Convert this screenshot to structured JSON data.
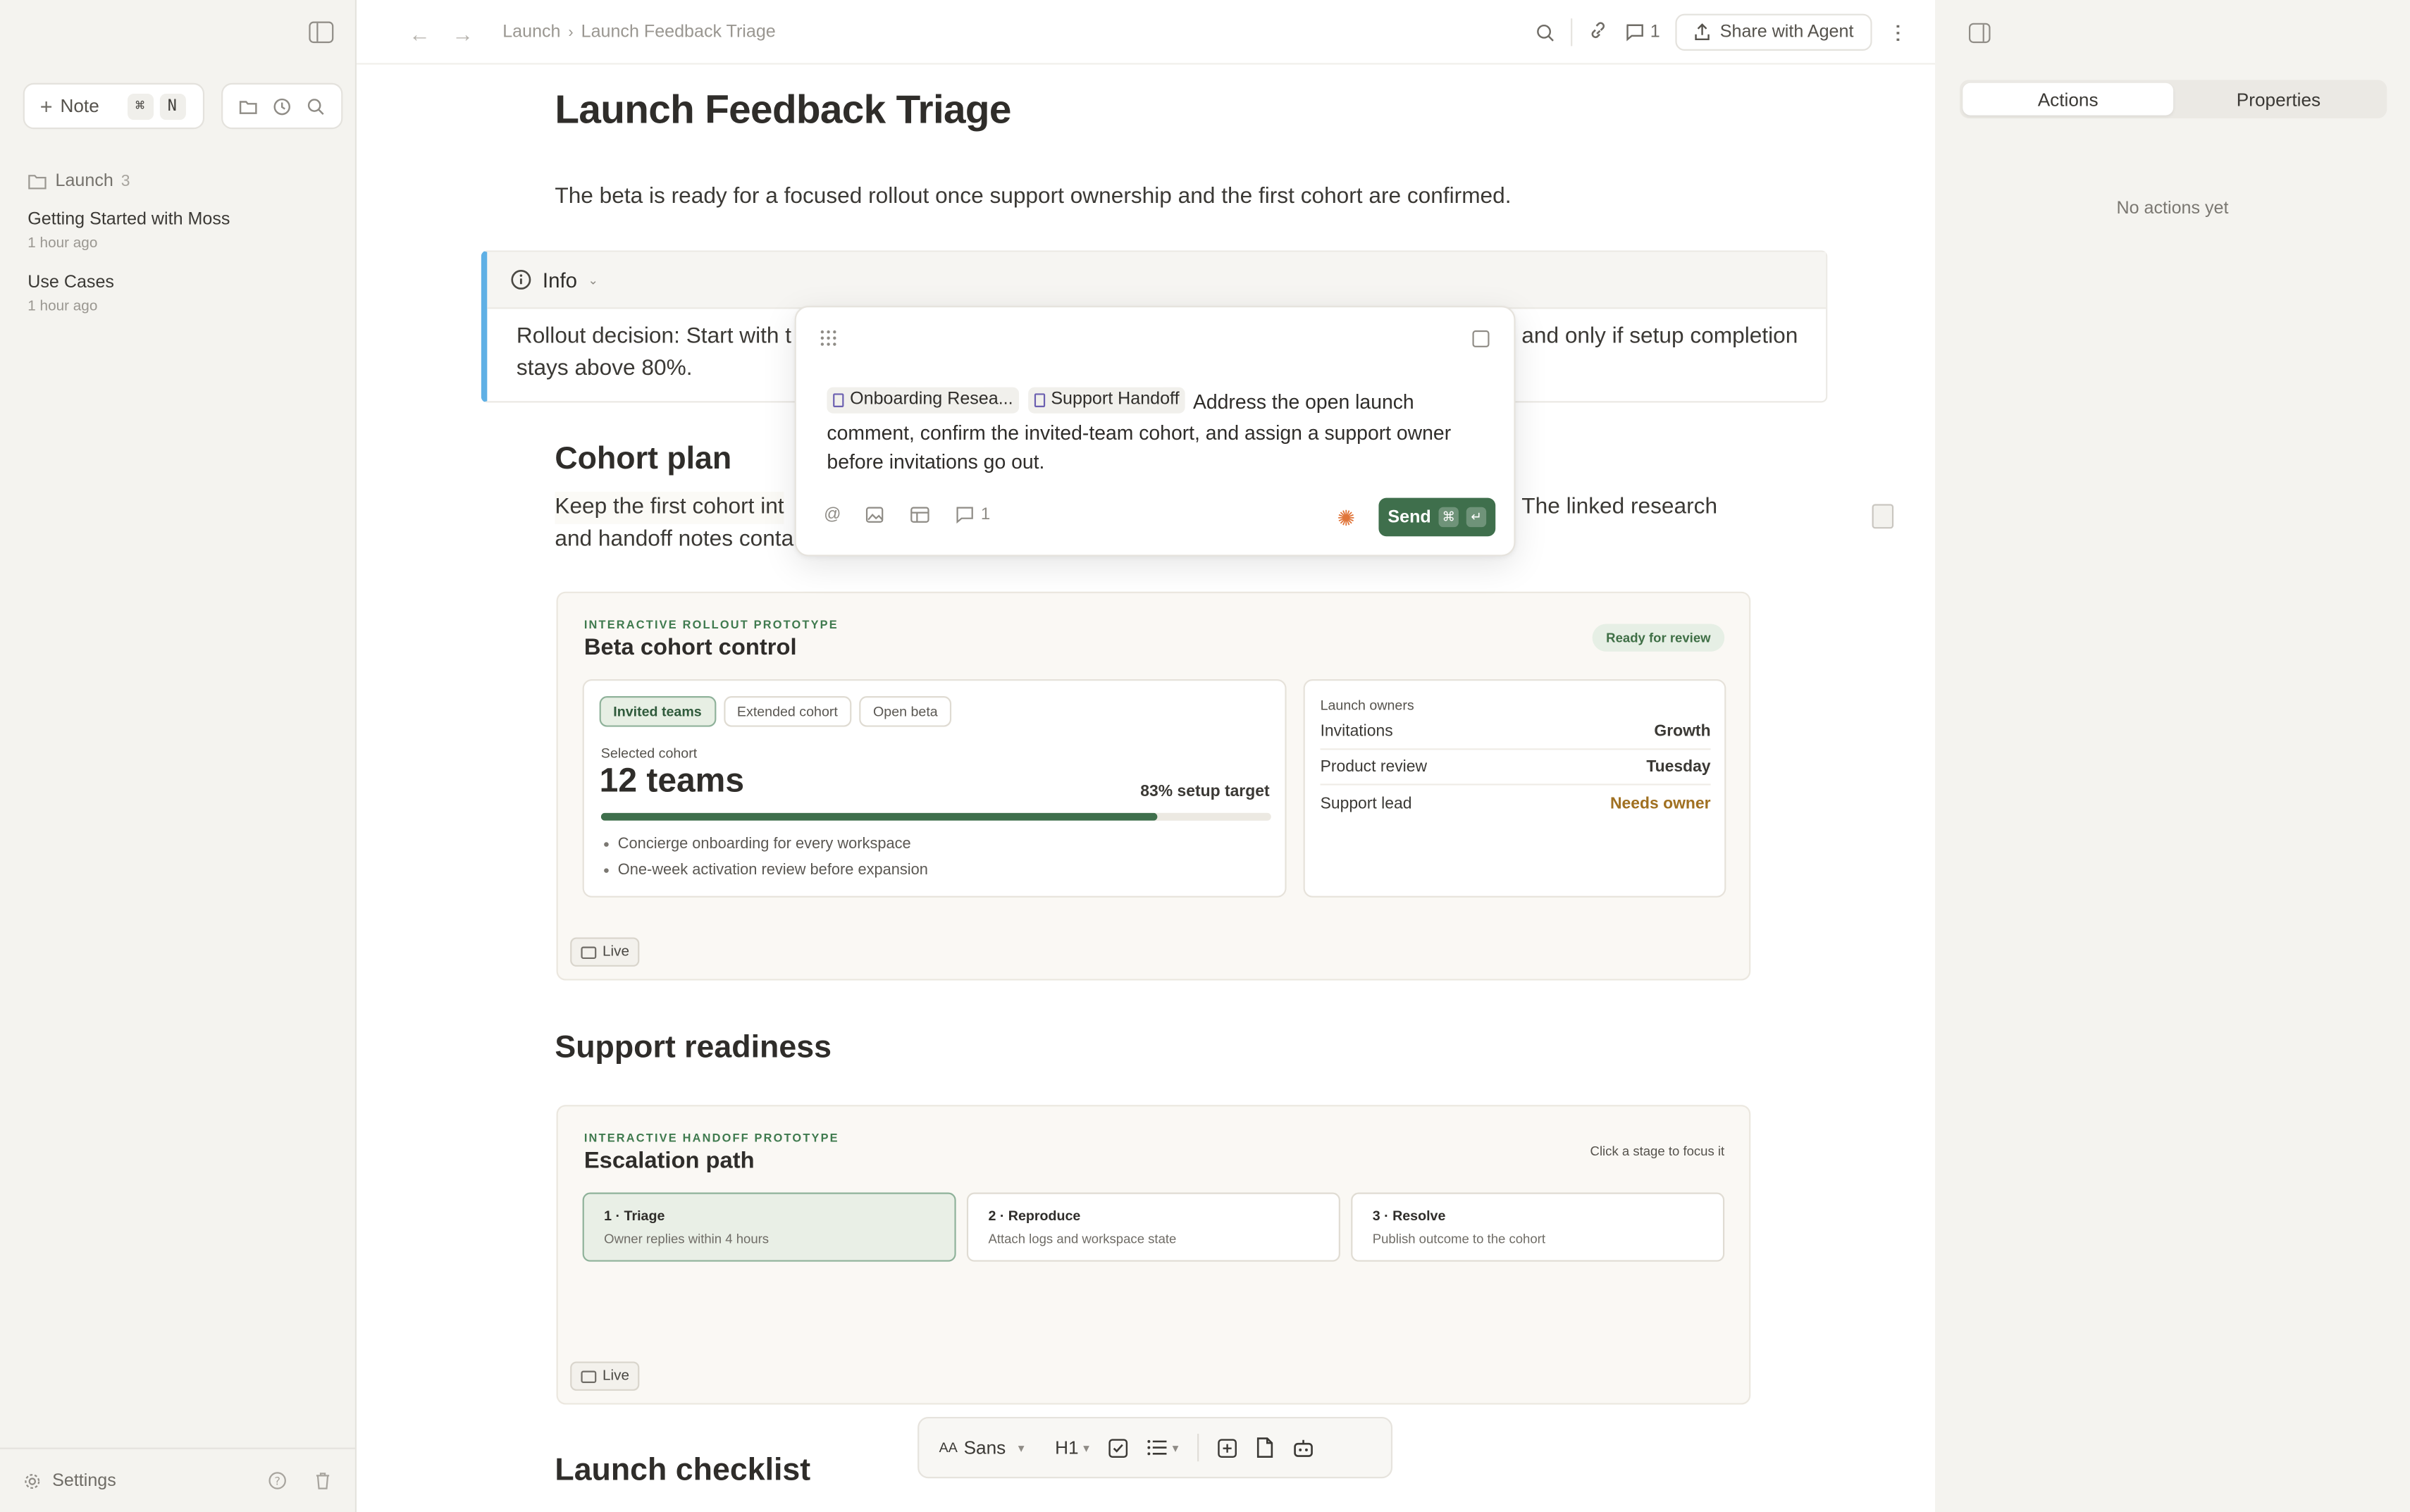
{
  "sidebar": {
    "new_note_label": "Note",
    "shortcut_cmd": "⌘",
    "shortcut_key": "N",
    "folder": {
      "name": "Launch",
      "count": "3"
    },
    "documents": [
      {
        "title": "Getting Started with Moss",
        "time": "1 hour ago"
      },
      {
        "title": "Use Cases",
        "time": "1 hour ago"
      }
    ],
    "settings_label": "Settings"
  },
  "topbar": {
    "breadcrumb": [
      "Launch",
      "Launch Feedback Triage"
    ],
    "comment_count": "1",
    "share_label": "Share with Agent"
  },
  "doc": {
    "title": "Launch Feedback Triage",
    "intro": "The beta is ready for a focused rollout once support ownership and the first cohort are confirmed.",
    "callout": {
      "label": "Info",
      "line1_start": "Rollout decision: Start with t",
      "line1_end": "and only if setup completion",
      "line2": "stays above 80%."
    },
    "cohort_heading": "Cohort plan",
    "cohort_para": {
      "line1_start": "Keep the first cohort int",
      "line1_end": "The linked research",
      "line2": "and handoff notes conta"
    },
    "support_heading": "Support readiness",
    "checklist_heading": "Launch checklist"
  },
  "rollout_proto": {
    "eyebrow": "INTERACTIVE ROLLOUT PROTOTYPE",
    "title": "Beta cohort control",
    "badge": "Ready for review",
    "chips": [
      "Invited teams",
      "Extended cohort",
      "Open beta"
    ],
    "active_chip": 0,
    "selected_label": "Selected cohort",
    "selected_value": "12 teams",
    "target_label": "83% setup target",
    "progress_fraction": 0.83,
    "bullets": [
      "Concierge onboarding for every workspace",
      "One-week activation review before expansion"
    ],
    "owners_label": "Launch owners",
    "owners": [
      {
        "role": "Invitations",
        "value": "Growth",
        "warn": false
      },
      {
        "role": "Product review",
        "value": "Tuesday",
        "warn": false
      },
      {
        "role": "Support lead",
        "value": "Needs owner",
        "warn": true
      }
    ],
    "live_label": "Live"
  },
  "handoff_proto": {
    "eyebrow": "INTERACTIVE HANDOFF PROTOTYPE",
    "title": "Escalation path",
    "hint": "Click a stage to focus it",
    "stages": [
      {
        "title": "1 · Triage",
        "sub": "Owner replies within 4 hours"
      },
      {
        "title": "2 · Reproduce",
        "sub": "Attach logs and workspace state"
      },
      {
        "title": "3 · Resolve",
        "sub": "Publish outcome to the cohort"
      }
    ],
    "active_stage": 0,
    "live_label": "Live"
  },
  "composer": {
    "refs": [
      "Onboarding Resea...",
      "Support Handoff"
    ],
    "text": "Address the open launch comment, confirm the invited-team cohort, and assign a support owner before invitations go out.",
    "comment_count": "1",
    "send_label": "Send",
    "send_kbd": [
      "⌘",
      "↵"
    ]
  },
  "format_bar": {
    "font_label": "Sans",
    "font_prefix": "AA",
    "heading_label": "H1"
  },
  "right_panel": {
    "tabs": [
      "Actions",
      "Properties"
    ],
    "active_tab": 0,
    "empty_text": "No actions yet"
  },
  "colors": {
    "accent_green": "#3f6f4c",
    "callout_blue": "#5fb0e5",
    "warn": "#a07021"
  }
}
